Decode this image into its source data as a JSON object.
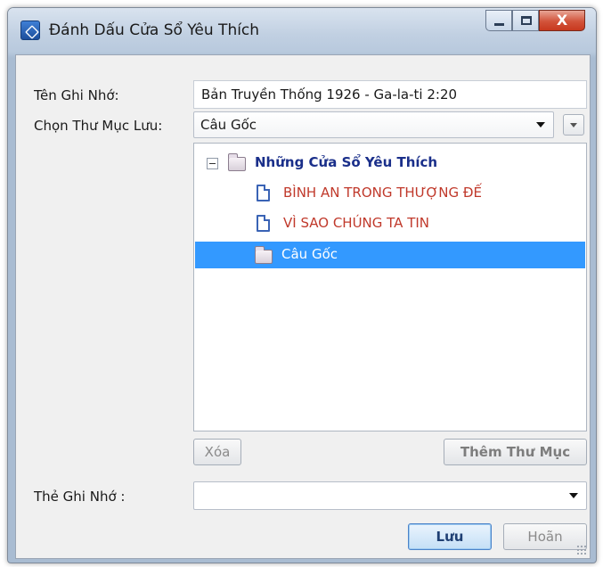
{
  "window": {
    "title": "Đánh Dấu Cửa Sổ Yêu Thích",
    "close_glyph": "X"
  },
  "form": {
    "bookmark_name_label": "Tên Ghi Nhớ:",
    "bookmark_name_value": "Bản Truyền Thống 1926 - Ga-la-ti 2:20",
    "folder_label": "Chọn Thư Mục Lưu:",
    "folder_selected": "Câu Gốc",
    "tag_label": "Thẻ Ghi Nhớ :",
    "tag_value": ""
  },
  "tree": {
    "root": {
      "label": "Những Cửa Sổ Yêu Thích",
      "color": "#1a2f8a",
      "expanded": true
    },
    "children": [
      {
        "label": "BÌNH AN TRONG THƯỢNG ĐẾ",
        "type": "document",
        "color": "#c0392b"
      },
      {
        "label": "VÌ SAO CHÚNG TA TIN",
        "type": "document",
        "color": "#c0392b"
      },
      {
        "label": "Câu Gốc",
        "type": "folder",
        "selected": true,
        "color": "#ffffff"
      }
    ],
    "selection_color": "#3399ff"
  },
  "buttons": {
    "delete_label": "Xóa",
    "add_folder_label": "Thêm Thư Mục",
    "save_label": "Lưu",
    "cancel_label": "Hoãn"
  }
}
